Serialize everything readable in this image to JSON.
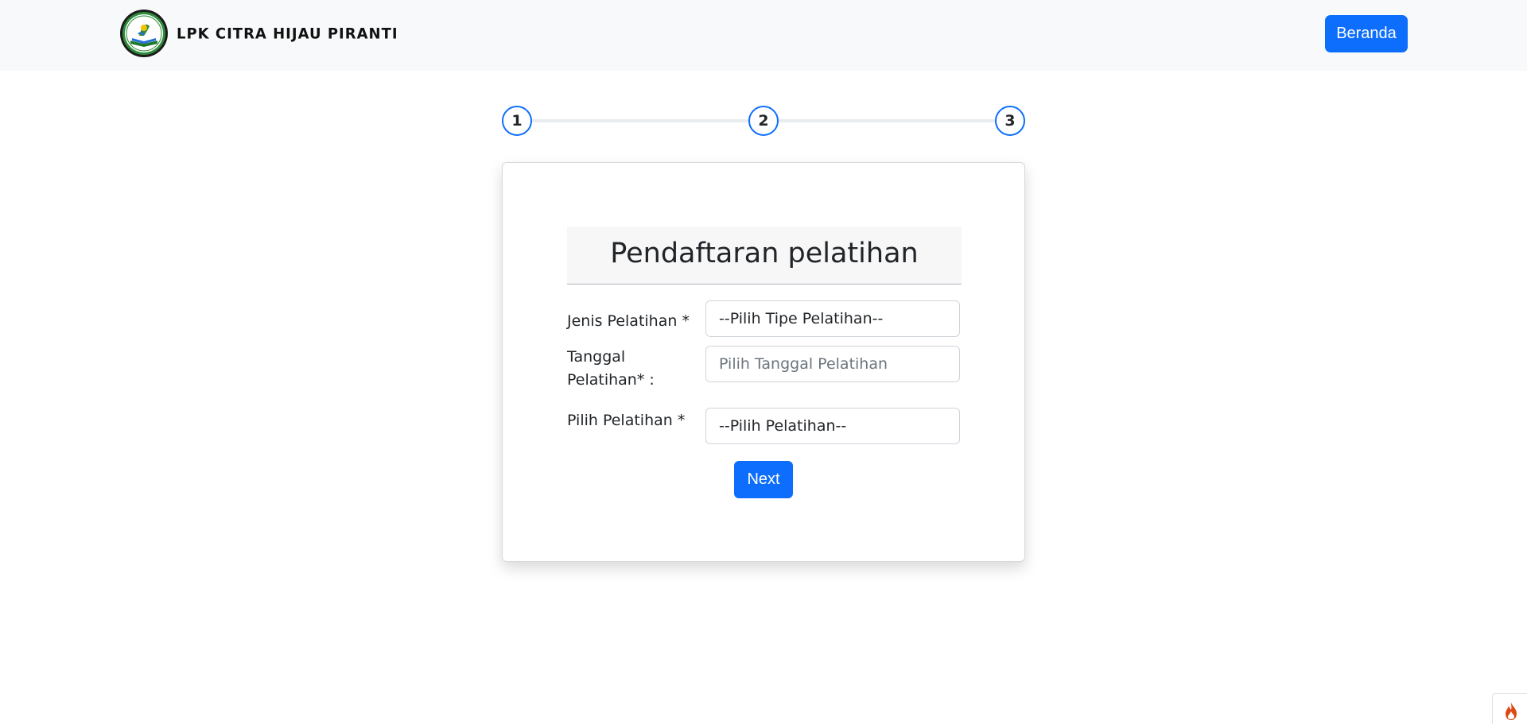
{
  "navbar": {
    "brand_name": "LPK CITRA HIJAU PIRANTI",
    "logo_icon": "organization-logo-icon",
    "home_button_label": "Beranda"
  },
  "stepper": {
    "steps": [
      "1",
      "2",
      "3"
    ]
  },
  "form": {
    "title": "Pendaftaran pelatihan",
    "jenis_label": "Jenis Pelatihan *",
    "jenis_value": "--Pilih Tipe Pelatihan--",
    "tanggal_label": "Tanggal Pelatihan* :",
    "tanggal_placeholder": "Pilih Tanggal Pelatihan",
    "pilih_label": "Pilih Pelatihan *",
    "pilih_value": "--Pilih Pelatihan--",
    "next_label": "Next"
  },
  "debug_toolbar": {
    "icon": "flame-icon"
  },
  "colors": {
    "primary": "#0d6efd",
    "navbar_bg": "#f8f9fa",
    "title_bg": "#f7f7f7"
  }
}
